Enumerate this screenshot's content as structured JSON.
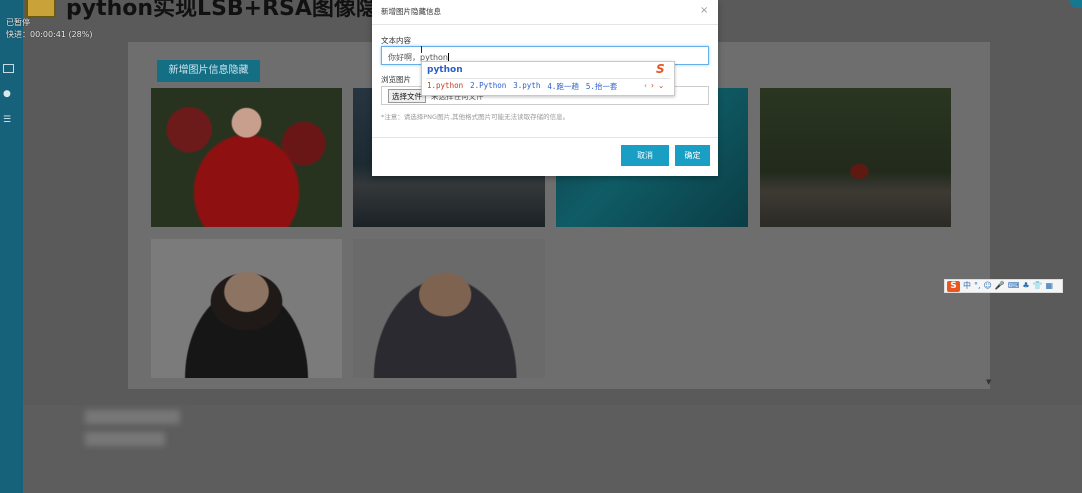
{
  "app": {
    "title": "python实现LSB+RSA图像隐藏"
  },
  "overlay": {
    "line1": "已暂停",
    "line2": "快进：00:00:41 (28%)"
  },
  "main": {
    "add_button_label": "新增图片信息隐藏",
    "photos": [
      "photo-woman-flower-crown",
      "photo-pier-night",
      "photo-teal-scene",
      "photo-woman-in-water",
      "photo-woman-portrait",
      "photo-man-portrait"
    ]
  },
  "modal": {
    "title": "新增图片隐藏信息",
    "close_symbol": "×",
    "text_label": "文本内容",
    "text_value_prefix": "你好啊，",
    "text_value_composing": "python",
    "browse_label": "浏览图片",
    "file_button_label": "选择文件",
    "file_status": "未选择任何文件",
    "note": "*注意：请选择PNG图片,其他格式图片可能无法读取存储的信息。",
    "cancel_label": "取消",
    "confirm_label": "确定"
  },
  "ime_popup": {
    "composition": "python",
    "logo": "S",
    "candidates": [
      "1.python",
      "2.Python",
      "3.pyth",
      "4.跑一趟",
      "5.抬一套"
    ],
    "nav_prev": "‹",
    "nav_next": "›",
    "nav_more": "⌄"
  },
  "ime_toolbar": {
    "logo": "S",
    "items": [
      "中",
      "°,",
      "☺",
      "🎤",
      "⌨",
      "♣",
      "👕",
      "▦"
    ]
  },
  "colors": {
    "accent": "#1a9fc4",
    "rail": "#16627a",
    "ime_orange": "#e9561f",
    "candidate_blue": "#2b5fc8"
  }
}
